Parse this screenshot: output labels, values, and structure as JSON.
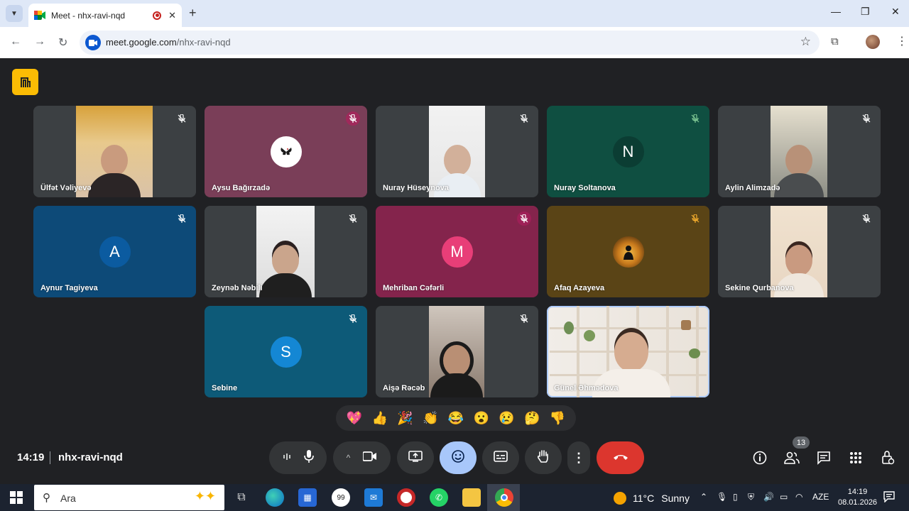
{
  "browser": {
    "tab_title": "Meet - nhx-ravi-nqd",
    "tab_close": "✕",
    "new_tab": "+",
    "url_host": "meet.google.com",
    "url_path": "/nhx-ravi-nqd",
    "window_controls": [
      "—",
      "❐",
      "✕"
    ]
  },
  "participants": [
    {
      "name": "Ülfət Vəliyevə",
      "type": "video"
    },
    {
      "name": "Aysu Bağırzadə",
      "type": "image-avatar"
    },
    {
      "name": "Nuray Hüseynova",
      "type": "video"
    },
    {
      "name": "Nuray Soltanova",
      "type": "letter",
      "letter": "N"
    },
    {
      "name": "Aylin Alimzadə",
      "type": "video"
    },
    {
      "name": "Aynur Tagiyeva",
      "type": "letter",
      "letter": "A"
    },
    {
      "name": "Zeynəb Nəbili",
      "type": "video"
    },
    {
      "name": "Mehriban Cəfərli",
      "type": "letter",
      "letter": "M"
    },
    {
      "name": "Afaq Azayeva",
      "type": "image-avatar"
    },
    {
      "name": "Sekine Qurbanova",
      "type": "video"
    },
    {
      "name": "Sebine",
      "type": "letter",
      "letter": "S"
    },
    {
      "name": "Aişə Rəcəb",
      "type": "video"
    },
    {
      "name": "Günel Əhmədova",
      "type": "video",
      "selected": true
    }
  ],
  "reactions": [
    "💖",
    "👍",
    "🎉",
    "👏",
    "😂",
    "😮",
    "😢",
    "🤔",
    "👎"
  ],
  "meeting": {
    "time": "14:19",
    "code": "nhx-ravi-nqd",
    "participant_count": "13"
  },
  "taskbar": {
    "search_placeholder": "Ara",
    "weather_temp": "11°C",
    "weather_text": "Sunny",
    "language": "AZE",
    "time": "14:19",
    "date": "08.01.2026"
  },
  "colors": {
    "meet_bg": "#202124",
    "end_call": "#dc362e",
    "active_control": "#a8c7fa",
    "badge_yellow": "#fbbc04"
  }
}
